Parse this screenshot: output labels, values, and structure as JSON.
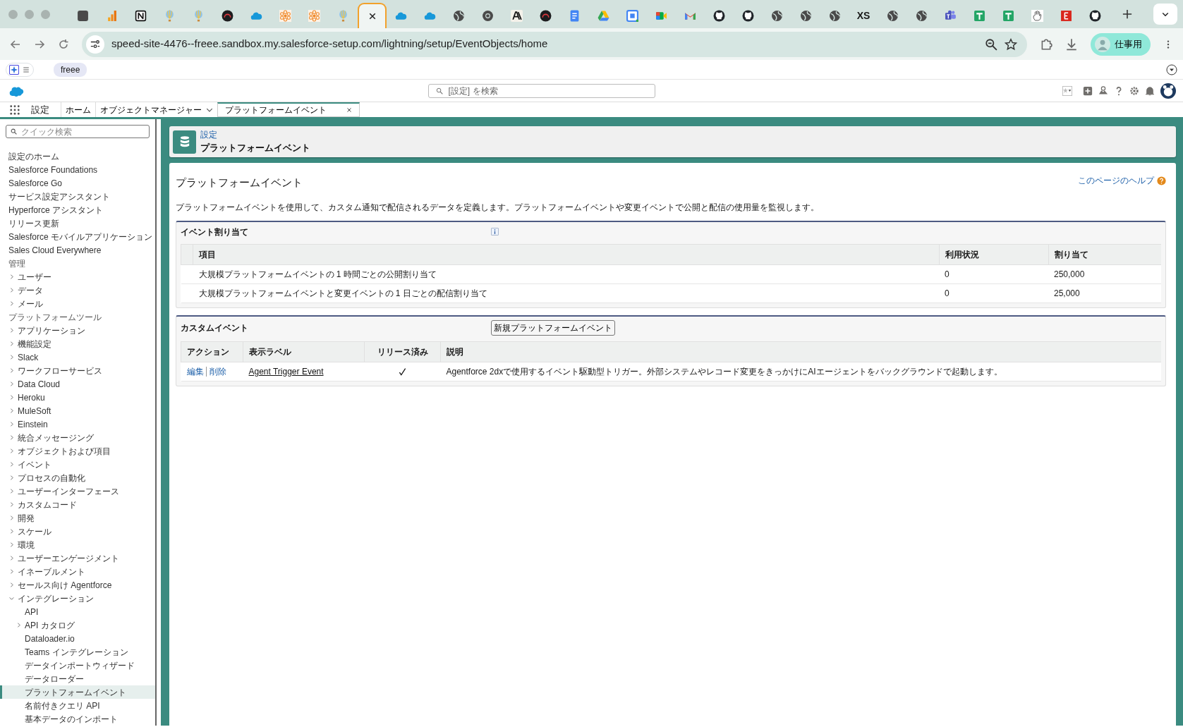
{
  "browser": {
    "tabs": [
      {
        "kind": "app",
        "selected": false
      },
      {
        "kind": "bars",
        "selected": false
      },
      {
        "kind": "notion",
        "selected": false
      },
      {
        "kind": "balloon",
        "selected": false
      },
      {
        "kind": "balloon",
        "selected": false
      },
      {
        "kind": "dark",
        "selected": false
      },
      {
        "kind": "cloud",
        "selected": false
      },
      {
        "kind": "flower",
        "selected": false
      },
      {
        "kind": "flower",
        "selected": false
      },
      {
        "kind": "balloon",
        "selected": false
      },
      {
        "kind": "blank",
        "selected": true
      },
      {
        "kind": "cloud",
        "selected": false
      },
      {
        "kind": "cloud",
        "selected": false
      },
      {
        "kind": "globe",
        "selected": false
      },
      {
        "kind": "chrome",
        "selected": false
      },
      {
        "kind": "slash",
        "selected": false
      },
      {
        "kind": "dark",
        "selected": false
      },
      {
        "kind": "docs",
        "selected": false
      },
      {
        "kind": "drive",
        "selected": false
      },
      {
        "kind": "calendar",
        "selected": false
      },
      {
        "kind": "meet",
        "selected": false
      },
      {
        "kind": "gmail",
        "selected": false
      },
      {
        "kind": "github",
        "selected": false
      },
      {
        "kind": "github",
        "selected": false
      },
      {
        "kind": "globe",
        "selected": false
      },
      {
        "kind": "globe",
        "selected": false
      },
      {
        "kind": "globe",
        "selected": false
      },
      {
        "kind": "text",
        "text": "XS",
        "selected": false
      },
      {
        "kind": "globe",
        "selected": false
      },
      {
        "kind": "globe",
        "selected": false
      },
      {
        "kind": "teams",
        "selected": false
      },
      {
        "kind": "sheets",
        "selected": false
      },
      {
        "kind": "sheets",
        "selected": false
      },
      {
        "kind": "hand",
        "selected": false
      },
      {
        "kind": "esq",
        "selected": false
      },
      {
        "kind": "github",
        "selected": false
      }
    ],
    "url": "speed-site-4476--freee.sandbox.my.salesforce-setup.com/lightning/setup/EventObjects/home",
    "profile": "仕事用"
  },
  "extension_bar": {
    "toggle_on": true,
    "chip": "freee"
  },
  "header": {
    "search": {
      "placeholder": "[設定] を検索"
    }
  },
  "nav": {
    "app_name": "設定",
    "tabs": [
      {
        "label": "ホーム",
        "kind": "plain",
        "selected": false
      },
      {
        "label": "オブジェクトマネージャー",
        "kind": "menu",
        "selected": false
      },
      {
        "label": "プラットフォームイベント",
        "kind": "closable",
        "selected": true
      }
    ]
  },
  "sidebar": {
    "search": {
      "placeholder": "クイック検索"
    },
    "items": [
      {
        "label": "設定のホーム",
        "kind": "link",
        "selected": false
      },
      {
        "label": "Salesforce Foundations",
        "kind": "link",
        "selected": false
      },
      {
        "label": "Salesforce Go",
        "kind": "link",
        "selected": false
      },
      {
        "label": "サービス設定アシスタント",
        "kind": "link",
        "selected": false
      },
      {
        "label": "Hyperforce アシスタント",
        "kind": "link",
        "selected": false
      },
      {
        "label": "リリース更新",
        "kind": "link",
        "selected": false
      },
      {
        "label": "Salesforce モバイルアプリケーション",
        "kind": "link",
        "selected": false
      },
      {
        "label": "Sales Cloud Everywhere",
        "kind": "link",
        "selected": false
      },
      {
        "label": "管理",
        "kind": "heading"
      },
      {
        "label": "ユーザー",
        "kind": "group",
        "expanded": false,
        "selected": false
      },
      {
        "label": "データ",
        "kind": "group",
        "expanded": false,
        "selected": false
      },
      {
        "label": "メール",
        "kind": "group",
        "expanded": false,
        "selected": false
      },
      {
        "label": "プラットフォームツール",
        "kind": "heading"
      },
      {
        "label": "アプリケーション",
        "kind": "group",
        "expanded": false,
        "selected": false
      },
      {
        "label": "機能設定",
        "kind": "group",
        "expanded": false,
        "selected": false
      },
      {
        "label": "Slack",
        "kind": "group",
        "expanded": false,
        "selected": false
      },
      {
        "label": "ワークフローサービス",
        "kind": "group",
        "expanded": false,
        "selected": false
      },
      {
        "label": "Data Cloud",
        "kind": "group",
        "expanded": false,
        "selected": false
      },
      {
        "label": "Heroku",
        "kind": "group",
        "expanded": false,
        "selected": false
      },
      {
        "label": "MuleSoft",
        "kind": "group",
        "expanded": false,
        "selected": false
      },
      {
        "label": "Einstein",
        "kind": "group",
        "expanded": false,
        "selected": false
      },
      {
        "label": "統合メッセージング",
        "kind": "group",
        "expanded": false,
        "selected": false
      },
      {
        "label": "オブジェクトおよび項目",
        "kind": "group",
        "expanded": false,
        "selected": false
      },
      {
        "label": "イベント",
        "kind": "group",
        "expanded": false,
        "selected": false
      },
      {
        "label": "プロセスの自動化",
        "kind": "group",
        "expanded": false,
        "selected": false
      },
      {
        "label": "ユーザーインターフェース",
        "kind": "group",
        "expanded": false,
        "selected": false
      },
      {
        "label": "カスタムコード",
        "kind": "group",
        "expanded": false,
        "selected": false
      },
      {
        "label": "開発",
        "kind": "group",
        "expanded": false,
        "selected": false
      },
      {
        "label": "スケール",
        "kind": "group",
        "expanded": false,
        "selected": false
      },
      {
        "label": "環境",
        "kind": "group",
        "expanded": false,
        "selected": false
      },
      {
        "label": "ユーザーエンゲージメント",
        "kind": "group",
        "expanded": false,
        "selected": false
      },
      {
        "label": "イネーブルメント",
        "kind": "group",
        "expanded": false,
        "selected": false
      },
      {
        "label": "セールス向け Agentforce",
        "kind": "group",
        "expanded": false,
        "selected": false
      },
      {
        "label": "インテグレーション",
        "kind": "group",
        "expanded": true,
        "selected": false,
        "children": [
          {
            "label": "API",
            "kind": "link",
            "selected": false
          },
          {
            "label": "API カタログ",
            "kind": "group",
            "expanded": false,
            "selected": false
          },
          {
            "label": "Dataloader.io",
            "kind": "link",
            "selected": false
          },
          {
            "label": "Teams インテグレーション",
            "kind": "link",
            "selected": false
          },
          {
            "label": "データインポートウィザード",
            "kind": "link",
            "selected": false
          },
          {
            "label": "データローダー",
            "kind": "link",
            "selected": false
          },
          {
            "label": "プラットフォームイベント",
            "kind": "link",
            "selected": true
          },
          {
            "label": "名前付きクエリ API",
            "kind": "link",
            "selected": false
          },
          {
            "label": "基本データのインポート",
            "kind": "link",
            "selected": false
          }
        ]
      }
    ]
  },
  "page_header": {
    "breadcrumb": "設定",
    "title": "プラットフォームイベント"
  },
  "content": {
    "title": "プラットフォームイベント",
    "help_link": "このページのヘルプ",
    "description": "プラットフォームイベントを使用して、カスタム通知で配信されるデータを定義します。プラットフォームイベントや変更イベントで公開と配信の使用量を監視します。",
    "allocations": {
      "title": "イベント割り当て",
      "columns": [
        "項目",
        "利用状況",
        "割り当て"
      ],
      "rows": [
        [
          "大規模プラットフォームイベントの 1 時間ごとの公開割り当て",
          "0",
          "250,000"
        ],
        [
          "大規模プラットフォームイベントと変更イベントの 1 日ごとの配信割り当て",
          "0",
          "25,000"
        ]
      ]
    },
    "custom_events": {
      "title": "カスタムイベント",
      "new_button": "新規プラットフォームイベント",
      "columns": [
        "アクション",
        "表示ラベル",
        "リリース済み",
        "説明"
      ],
      "rows": [
        {
          "actions": [
            "編集",
            "削除"
          ],
          "label": "Agent Trigger Event",
          "released": true,
          "description": "Agentforce 2dxで使用するイベント駆動型トリガー。外部システムやレコード変更をきっかけにAIエージェントをバックグラウンドで起動します。"
        }
      ]
    }
  }
}
